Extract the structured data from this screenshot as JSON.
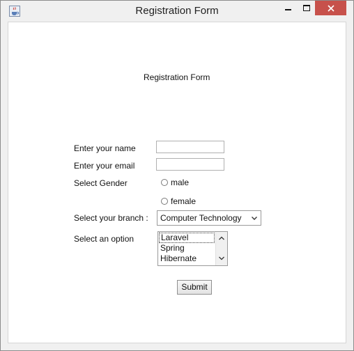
{
  "window": {
    "title": "Registration Form",
    "close_color": "#c7514b"
  },
  "form": {
    "heading": "Registration Form",
    "name_label": "Enter your name",
    "name_value": "",
    "email_label": "Enter your email",
    "email_value": "",
    "gender_label": "Select Gender",
    "gender_options": [
      "male",
      "female"
    ],
    "branch_label": "Select your branch :",
    "branch_selected": "Computer Technology",
    "option_label": "Select an option",
    "option_items": [
      "Laravel",
      "Spring",
      "Hibernate"
    ],
    "submit_label": "Submit"
  },
  "icons": {
    "app": "java-cup-icon",
    "minimize": "minimize-icon",
    "maximize": "maximize-icon",
    "close": "close-icon",
    "dropdown": "chevron-down-icon",
    "scroll_up": "scroll-up-icon",
    "scroll_down": "scroll-down-icon"
  }
}
